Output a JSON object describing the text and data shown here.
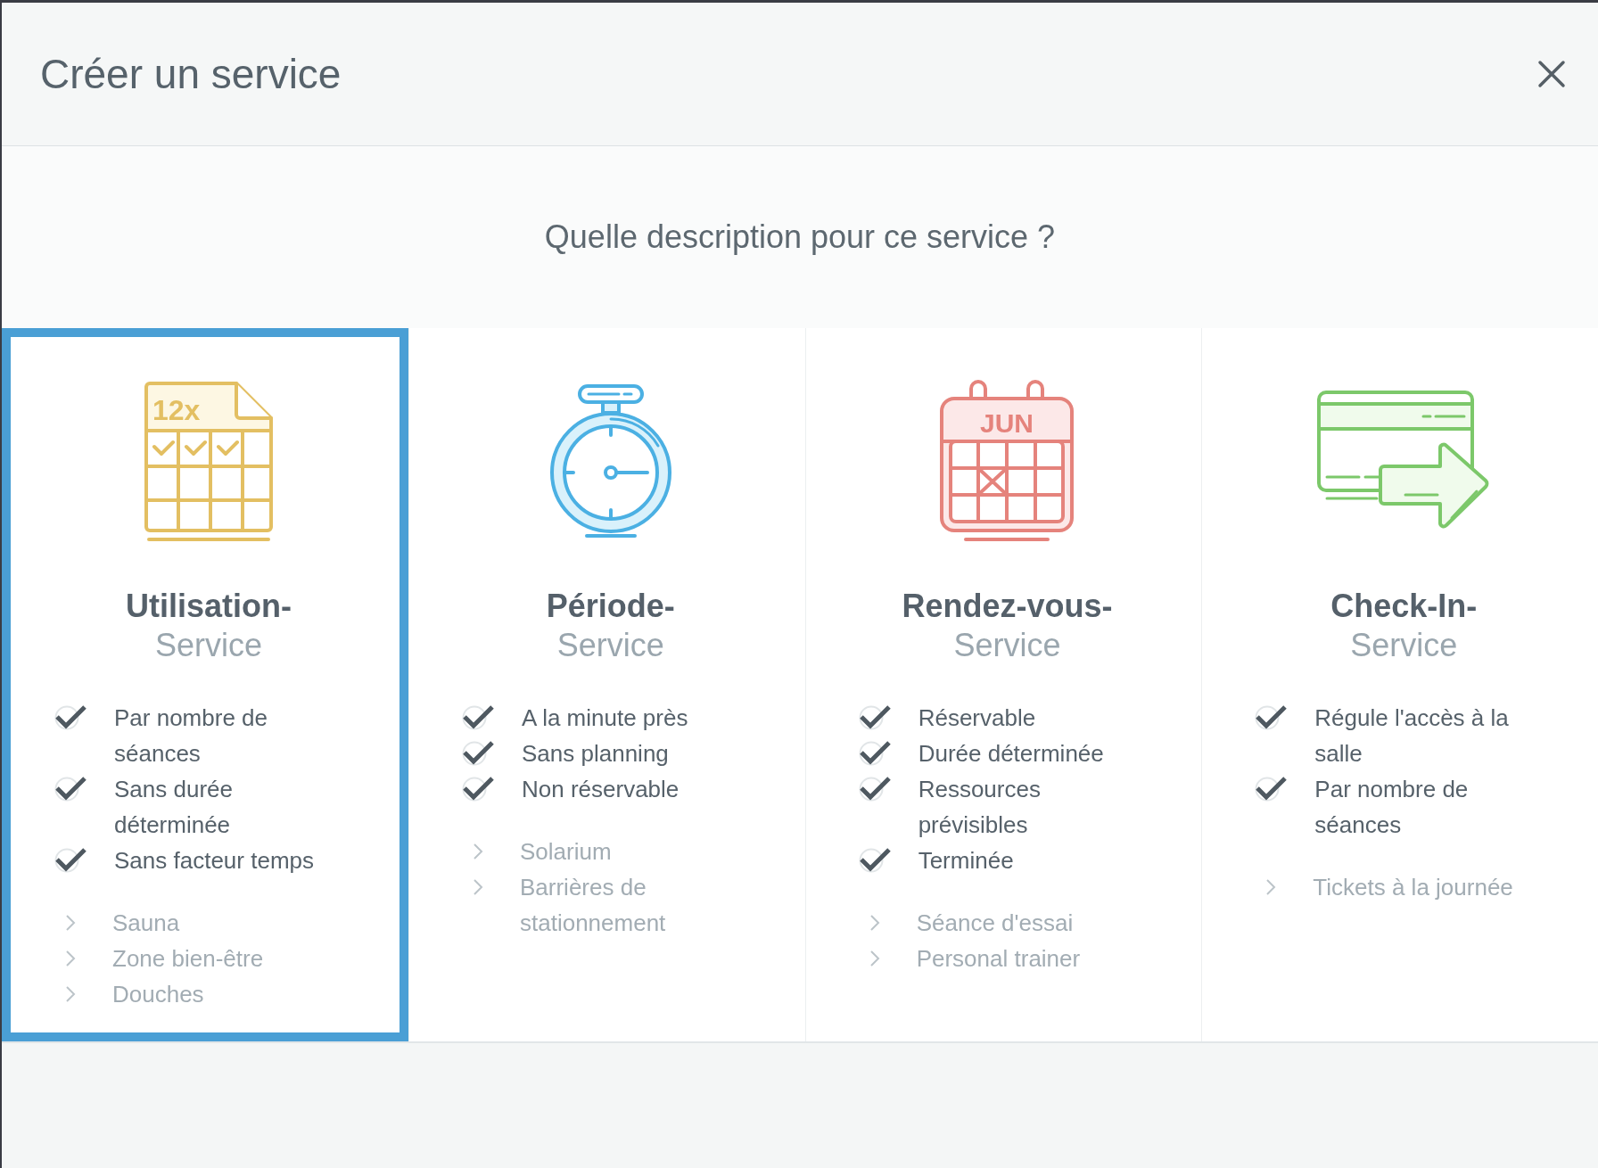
{
  "modal": {
    "title": "Créer un service"
  },
  "question": "Quelle description pour ce service ?",
  "cards": [
    {
      "kind": "usage",
      "icon_text": "12x",
      "title": "Utilisation-",
      "subtitle": "Service",
      "selected": true,
      "features": [
        "Par nombre de séances",
        "Sans durée déterminée",
        "Sans facteur temps"
      ],
      "examples": [
        "Sauna",
        "Zone bien-être",
        "Douches"
      ]
    },
    {
      "kind": "period",
      "title": "Période-",
      "subtitle": "Service",
      "selected": false,
      "features": [
        "A la minute près",
        "Sans planning",
        "Non réservable"
      ],
      "examples": [
        "Solarium",
        "Barrières de stationnement"
      ]
    },
    {
      "kind": "appointment",
      "icon_text": "JUN",
      "title": "Rendez-vous-",
      "subtitle": "Service",
      "selected": false,
      "features": [
        "Réservable",
        "Durée déterminée",
        "Ressources prévisibles",
        "Terminée"
      ],
      "examples": [
        "Séance d'essai",
        "Personal trainer"
      ]
    },
    {
      "kind": "checkin",
      "title": "Check-In-",
      "subtitle": "Service",
      "selected": false,
      "features": [
        "Régule l'accès à la salle",
        "Par nombre de séances"
      ],
      "examples": [
        "Tickets à la journée"
      ]
    }
  ]
}
